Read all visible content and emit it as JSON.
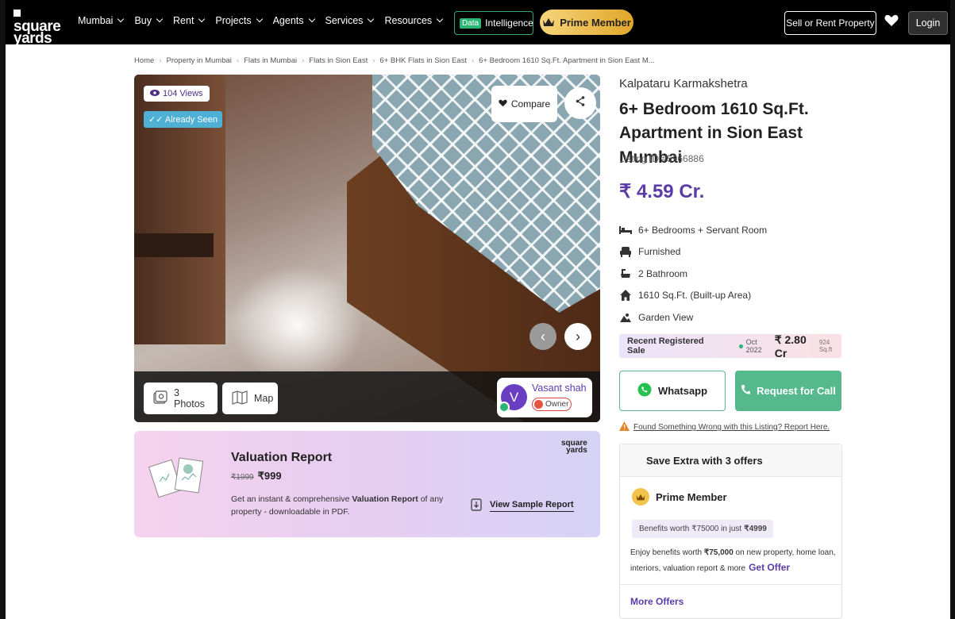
{
  "nav": {
    "logo_line1": "square",
    "logo_line2": "yards",
    "menu": [
      "Mumbai",
      "Buy",
      "Rent",
      "Projects",
      "Agents",
      "Services",
      "Resources"
    ],
    "intel_tag": "Data",
    "intel_label": "Intelligence",
    "prime_label": "Prime Member",
    "sell_label": "Sell or Rent Property",
    "login_label": "Login"
  },
  "breadcrumb": [
    "Home",
    "Property in Mumbai",
    "Flats in Mumbai",
    "Flats in Sion East",
    "6+ BHK Flats in Sion East",
    "6+ Bedroom 1610 Sq.Ft. Apartment in Sion East M..."
  ],
  "gallery": {
    "views": "104 Views",
    "already_seen": "Already Seen",
    "compare": "Compare",
    "photos": "3 Photos",
    "map": "Map",
    "agent_initial": "V",
    "agent_name": "Vasant shah",
    "agent_role": "Owner"
  },
  "valuation": {
    "logo_line1": "square",
    "logo_line2": "yards",
    "title": "Valuation Report",
    "old_price": "₹1999",
    "new_price": "₹999",
    "desc_pre": "Get an instant & comprehensive ",
    "desc_bold": "Valuation Report",
    "desc_post": " of any property - downloadable in PDF.",
    "sample": "View Sample Report"
  },
  "listing": {
    "project": "Kalpataru Karmakshetra",
    "title": "6+ Bedroom 1610 Sq.Ft. Apartment in Sion East Mumbai",
    "listing_id": "Listing ID #5966886",
    "price": "₹ 4.59 Cr.",
    "specs": [
      {
        "icon": "bed-icon",
        "text": "6+ Bedrooms + Servant Room"
      },
      {
        "icon": "sofa-icon",
        "text": "Furnished"
      },
      {
        "icon": "bathtub-icon",
        "text": "2 Bathroom"
      },
      {
        "icon": "home-icon",
        "text": "1610 Sq.Ft. (Built-up Area)"
      },
      {
        "icon": "landscape-icon",
        "text": "Garden View"
      }
    ]
  },
  "recent_sale": {
    "label": "Recent Registered Sale",
    "month": "Oct 2022",
    "amount": "₹ 2.80 Cr",
    "rate": "924 Sq.ft"
  },
  "actions": {
    "whatsapp": "Whatsapp",
    "call": "Request for Call",
    "report": "Found Something Wrong with this Listing? Report Here."
  },
  "offers": {
    "heading": "Save Extra with 3 offers",
    "prime_title": "Prime Member",
    "benefits_pre": "Benefits worth ₹75000 in just",
    "benefits_price": "₹4999",
    "enjoy_pre": "Enjoy benefits worth ",
    "enjoy_bold": "₹75,000",
    "enjoy_post": " on new property, home loan, interiors, valuation report & more",
    "get_offer": "Get Offer",
    "more": "More Offers"
  },
  "colors": {
    "accent": "#5b3ba8",
    "whatsapp_border": "#5bb88c",
    "call_bg": "#56b98e",
    "prime_gold": "#e0a62a"
  }
}
